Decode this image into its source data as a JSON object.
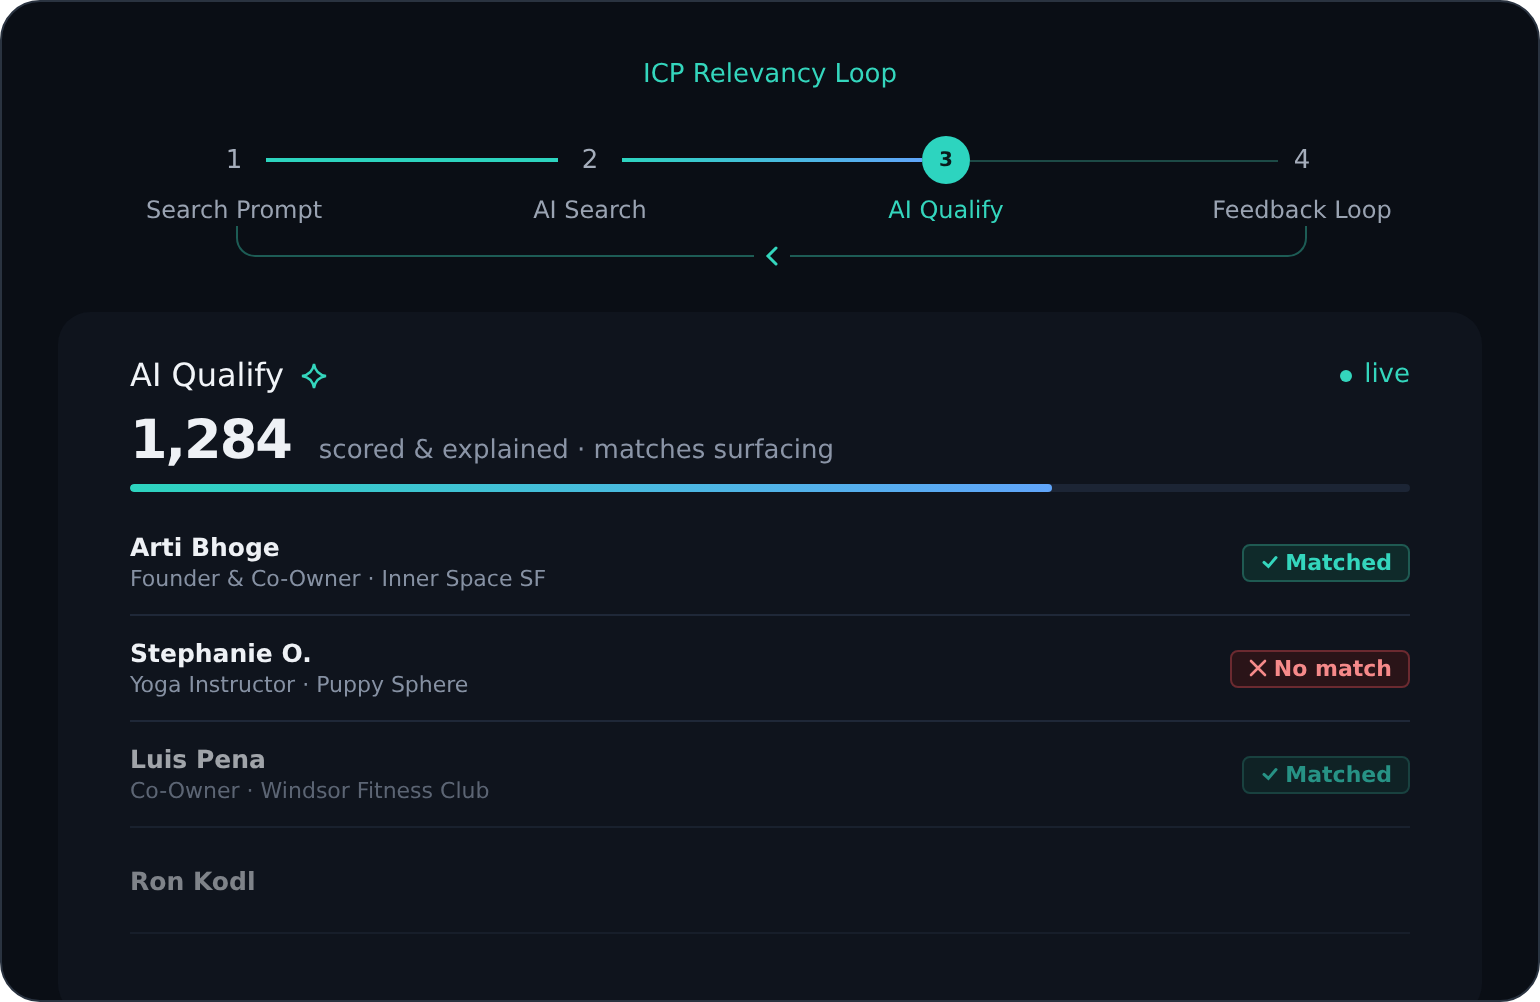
{
  "title": "ICP Relevancy Loop",
  "steps": [
    {
      "number": "1",
      "label": "Search Prompt",
      "selected": false
    },
    {
      "number": "2",
      "label": "AI Search",
      "selected": false
    },
    {
      "number": "3",
      "label": "AI Qualify",
      "selected": true
    },
    {
      "number": "4",
      "label": "Feedback Loop",
      "selected": false
    }
  ],
  "panel": {
    "title": "AI Qualify",
    "status": "live",
    "count": "1,284",
    "caption": "scored & explained · matches surfacing",
    "level": 0.72
  },
  "rows": [
    {
      "name": "Arti Bhoge",
      "subtitle": "Founder & Co-Owner · Inner Space SF",
      "badge": {
        "kind": "matched",
        "label": "Matched"
      }
    },
    {
      "name": "Stephanie O.",
      "subtitle": "Yoga Instructor · Puppy Sphere",
      "badge": {
        "kind": "no_match",
        "label": "No match"
      }
    },
    {
      "name": "Luis Pena",
      "subtitle": "Co-Owner · Windsor Fitness Club",
      "badge": {
        "kind": "matched",
        "label": "Matched"
      }
    },
    {
      "name": "Ron Kodl"
    }
  ]
}
